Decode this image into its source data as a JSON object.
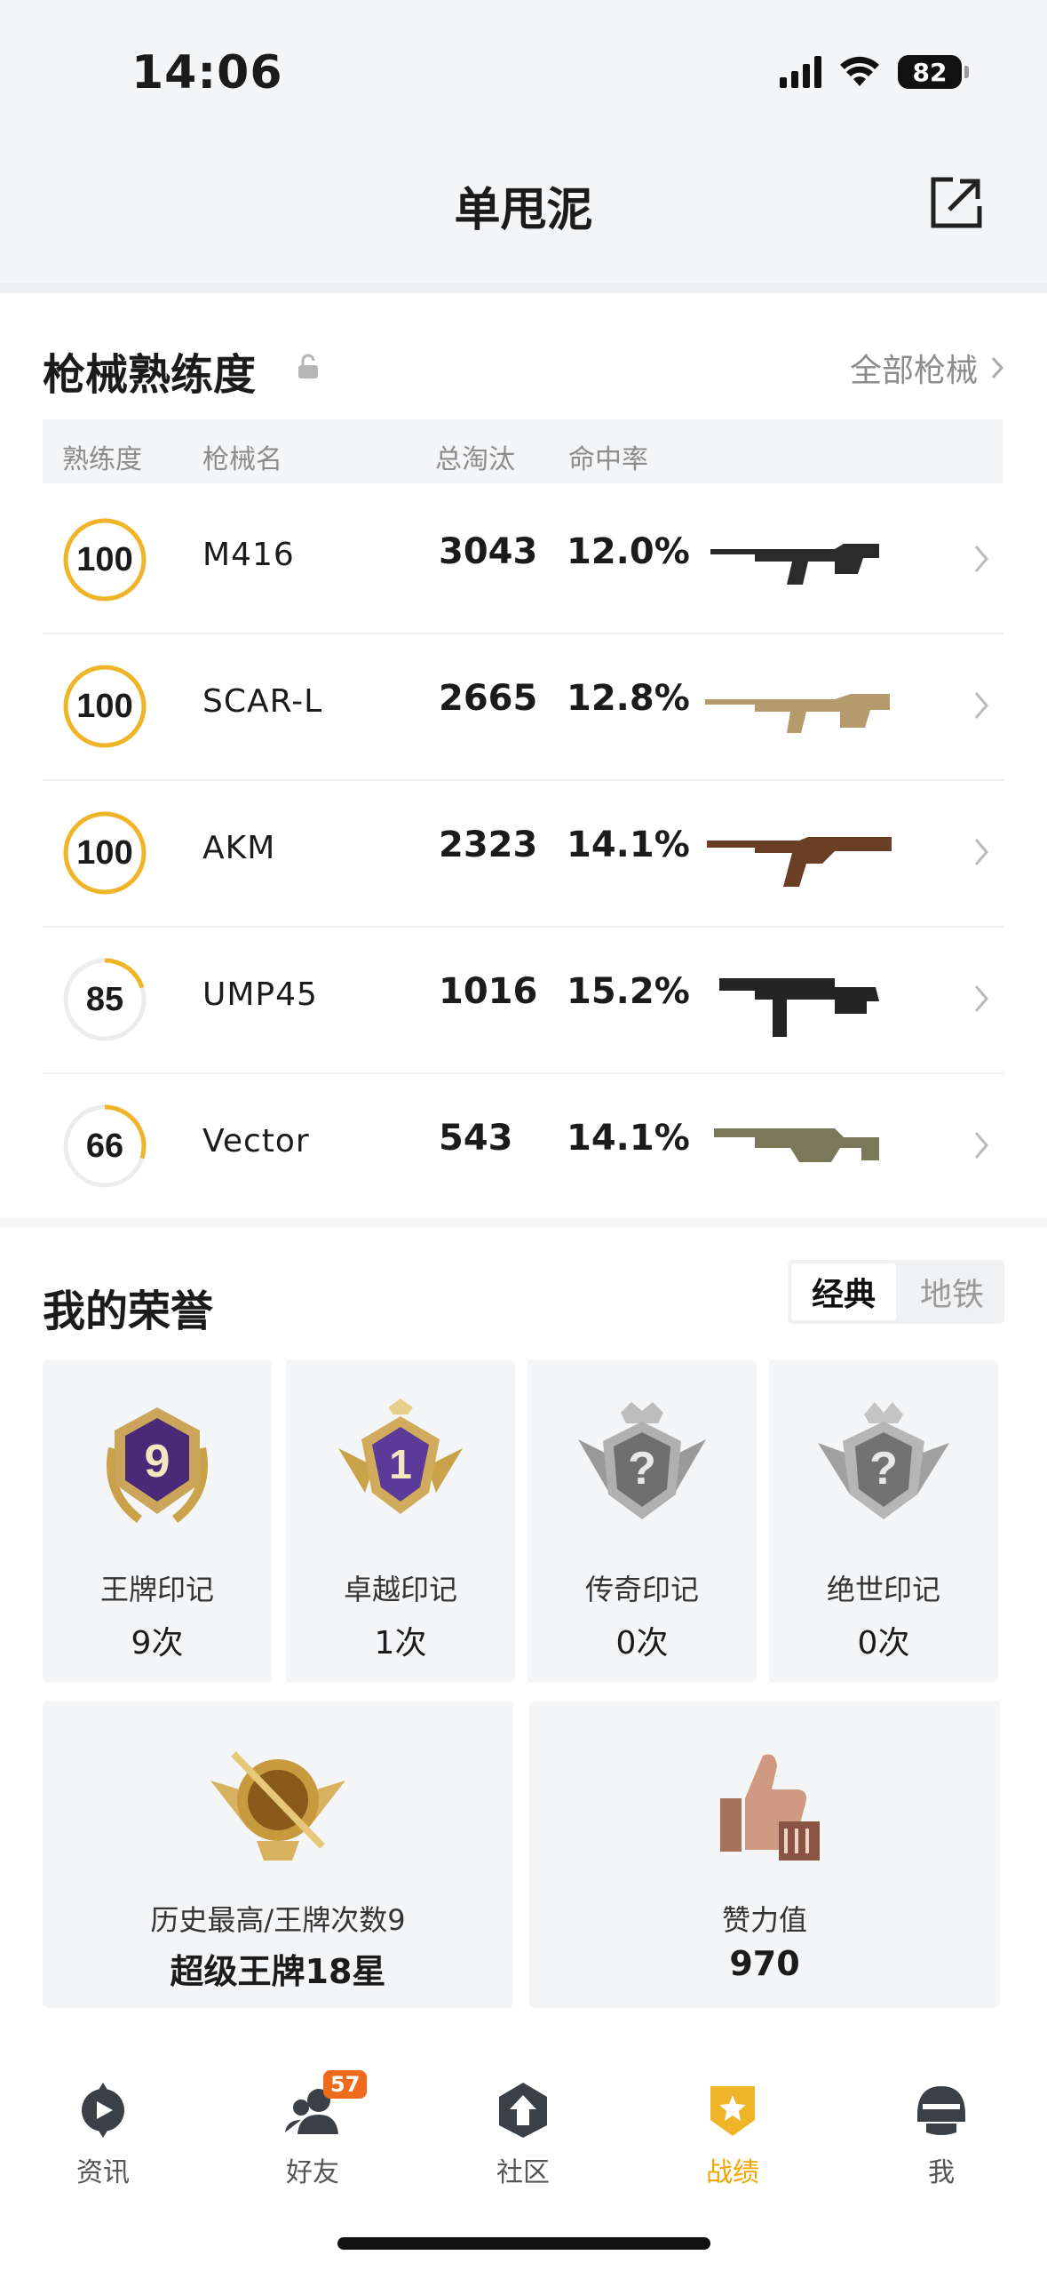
{
  "status": {
    "time": "14:06",
    "battery": "82"
  },
  "header": {
    "title": "单甩泥"
  },
  "weapons": {
    "title": "枪械熟练度",
    "all_link": "全部枪械",
    "columns": [
      "熟练度",
      "枪械名",
      "总淘汰",
      "命中率"
    ],
    "rows": [
      {
        "level": "100",
        "progress": 1.0,
        "name": "M416",
        "kills": "3043",
        "rate": "12.0%"
      },
      {
        "level": "100",
        "progress": 1.0,
        "name": "SCAR-L",
        "kills": "2665",
        "rate": "12.8%"
      },
      {
        "level": "100",
        "progress": 1.0,
        "name": "AKM",
        "kills": "2323",
        "rate": "14.1%"
      },
      {
        "level": "85",
        "progress": 0.2,
        "name": "UMP45",
        "kills": "1016",
        "rate": "15.2%"
      },
      {
        "level": "66",
        "progress": 0.3,
        "name": "Vector",
        "kills": "543",
        "rate": "14.1%"
      }
    ]
  },
  "honor": {
    "title": "我的荣誉",
    "toggle": [
      "经典",
      "地铁"
    ],
    "badges": [
      {
        "label": "王牌印记",
        "count": "9次"
      },
      {
        "label": "卓越印记",
        "count": "1次"
      },
      {
        "label": "传奇印记",
        "count": "0次"
      },
      {
        "label": "绝世印记",
        "count": "0次"
      }
    ],
    "best": {
      "label": "历史最高/王牌次数9",
      "value": "超级王牌18星"
    },
    "likes": {
      "label": "赞力值",
      "value": "970"
    }
  },
  "tabs": {
    "items": [
      "资讯",
      "好友",
      "社区",
      "战绩",
      "我"
    ],
    "friends_badge": "57",
    "active": "战绩"
  },
  "colors": {
    "accent": "#f0b429",
    "active_tab": "#f0a500"
  }
}
